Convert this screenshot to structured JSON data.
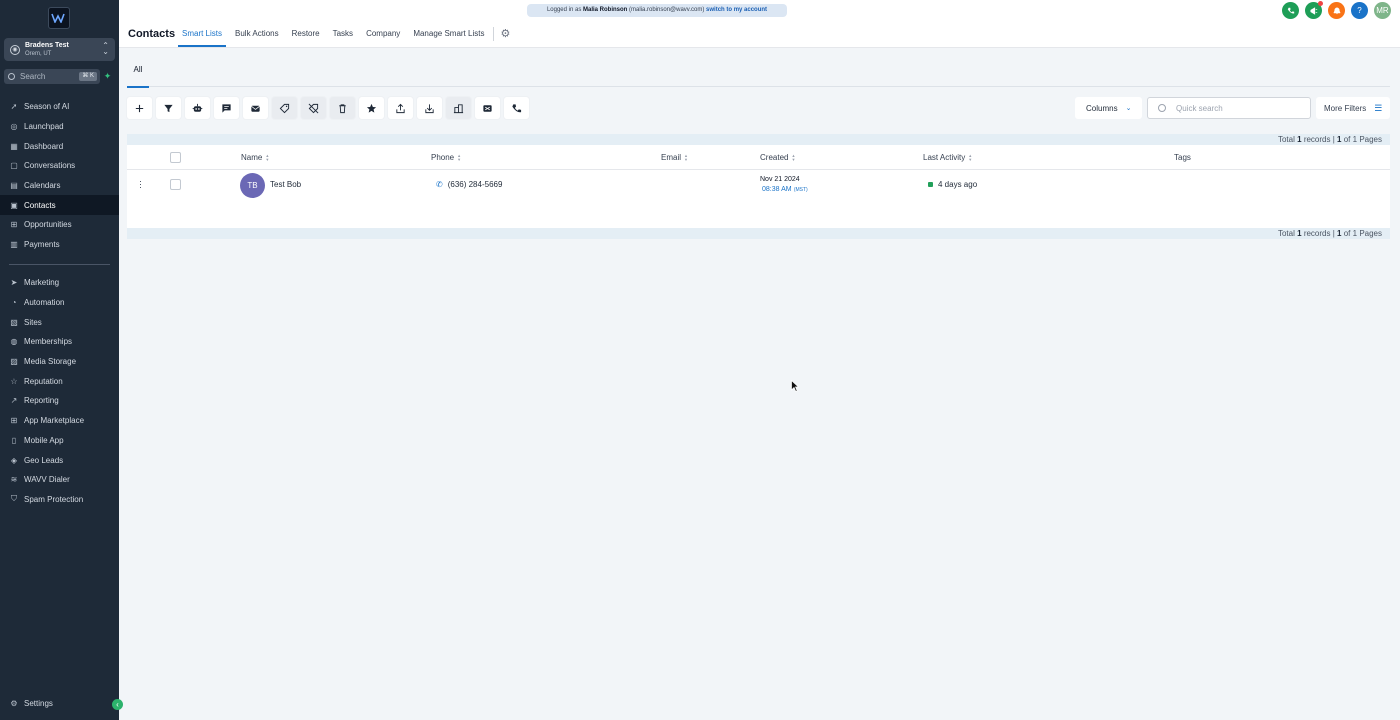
{
  "sidebar": {
    "account": {
      "name": "Bradens Test",
      "location": "Orem, UT"
    },
    "search": {
      "label": "Search",
      "shortcut": "⌘ K"
    },
    "items": [
      {
        "label": "Season of AI",
        "icon": "rocket-icon"
      },
      {
        "label": "Launchpad",
        "icon": "launchpad-icon"
      },
      {
        "label": "Dashboard",
        "icon": "dashboard-icon"
      },
      {
        "label": "Conversations",
        "icon": "chat-icon"
      },
      {
        "label": "Calendars",
        "icon": "calendar-icon"
      },
      {
        "label": "Contacts",
        "icon": "contacts-icon",
        "active": true
      },
      {
        "label": "Opportunities",
        "icon": "opportunities-icon"
      },
      {
        "label": "Payments",
        "icon": "payments-icon"
      }
    ],
    "items2": [
      {
        "label": "Marketing",
        "icon": "send-icon"
      },
      {
        "label": "Automation",
        "icon": "automation-icon"
      },
      {
        "label": "Sites",
        "icon": "sites-icon"
      },
      {
        "label": "Memberships",
        "icon": "memberships-icon"
      },
      {
        "label": "Media Storage",
        "icon": "media-icon"
      },
      {
        "label": "Reputation",
        "icon": "star-icon"
      },
      {
        "label": "Reporting",
        "icon": "reporting-icon"
      },
      {
        "label": "App Marketplace",
        "icon": "grid-icon"
      },
      {
        "label": "Mobile App",
        "icon": "mobile-icon"
      },
      {
        "label": "Geo Leads",
        "icon": "geo-icon"
      },
      {
        "label": "WAVV Dialer",
        "icon": "wavv-icon"
      },
      {
        "label": "Spam Protection",
        "icon": "shield-icon"
      }
    ],
    "settings_label": "Settings"
  },
  "header": {
    "title": "Contacts",
    "tabs": [
      "Smart Lists",
      "Bulk Actions",
      "Restore",
      "Tasks",
      "Company",
      "Manage Smart Lists"
    ],
    "banner": {
      "prefix": "Logged in as",
      "name": "Malia Robinson",
      "email": "(malia.robinson@wavv.com)",
      "link": "switch to my account"
    },
    "user_initials": "MR",
    "help_label": "?",
    "icon_colors": {
      "phone": "#1e9e57",
      "announce": "#1e9e57",
      "bell": "#f97316",
      "help": "#1a73c8",
      "avatar": "#7fb58a"
    }
  },
  "subtabs": {
    "all": "All"
  },
  "toolbar": {
    "icons": [
      "add-icon",
      "filter-icon",
      "robot-icon",
      "sms-icon",
      "email-icon",
      "add-tag-icon",
      "remove-tag-icon",
      "delete-icon",
      "star-icon",
      "export-icon",
      "import-icon",
      "company-icon",
      "mail-merge-icon",
      "call-icon"
    ],
    "columns_label": "Columns",
    "search_placeholder": "Quick search",
    "more_filters_label": "More Filters"
  },
  "summary": {
    "prefix": "Total",
    "records": "1",
    "mid": "records |",
    "page": "1",
    "of": "of",
    "pages": "1",
    "suffix": "Pages"
  },
  "table": {
    "headers": [
      "Name",
      "Phone",
      "Email",
      "Created",
      "Last Activity",
      "Tags"
    ],
    "rows": [
      {
        "initials": "TB",
        "name": "Test Bob",
        "phone": "(636) 284-5669",
        "email": "",
        "created_date": "Nov 21 2024",
        "created_time": "08:38 AM",
        "created_tz": "(MST)",
        "last_activity": "4 days ago",
        "tags": ""
      }
    ]
  }
}
